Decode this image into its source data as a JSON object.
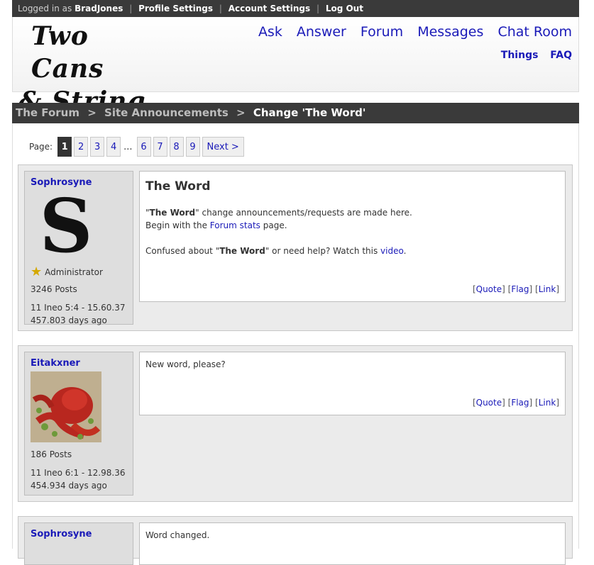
{
  "topbar": {
    "logged_in_as": "Logged in as",
    "username": "BradJones",
    "links": [
      "Profile Settings",
      "Account Settings",
      "Log Out"
    ],
    "sep": "|"
  },
  "logo": {
    "line1": "Two Cans",
    "line2": "& String"
  },
  "nav": {
    "main": [
      "Ask",
      "Answer",
      "Forum",
      "Messages",
      "Chat Room"
    ],
    "sub": [
      "Things",
      "FAQ"
    ]
  },
  "breadcrumb": {
    "forum": "The Forum",
    "section": "Site Announcements",
    "current": "Change 'The Word'",
    "sep": ">"
  },
  "pager": {
    "label": "Page:",
    "current": "1",
    "pages_a": [
      "2",
      "3",
      "4"
    ],
    "ellipsis": "...",
    "pages_b": [
      "6",
      "7",
      "8",
      "9"
    ],
    "next": "Next >"
  },
  "actions": {
    "open": "[",
    "close": "]",
    "quote": "Quote",
    "flag": "Flag",
    "link": "Link"
  },
  "posts": [
    {
      "author": "Sophrosyne",
      "role": "Administrator",
      "post_count": "3246 Posts",
      "date": "11 Ineo 5:4 - 15.60.37",
      "ago": "457.803 days ago",
      "title": "The Word",
      "line1_a": "\"",
      "line1_b": "The Word",
      "line1_c": "\" change announcements/requests are made here.",
      "line2_a": "Begin with the ",
      "line2_link": "Forum stats",
      "line2_b": " page.",
      "line3_a": "Confused about \"",
      "line3_b": "The Word",
      "line3_c": "\" or need help? Watch this ",
      "line3_link": "video",
      "line3_d": "."
    },
    {
      "author": "Eitakxner",
      "post_count": "186 Posts",
      "date": "11 Ineo 6:1 - 12.98.36",
      "ago": "454.934 days ago",
      "text": "New word, please?"
    },
    {
      "author": "Sophrosyne",
      "text": "Word changed."
    }
  ]
}
